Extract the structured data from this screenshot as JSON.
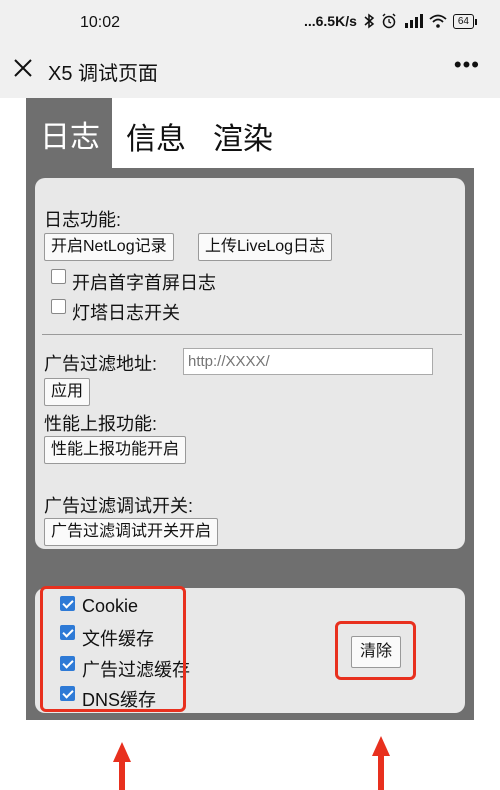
{
  "status_bar": {
    "time": "10:02",
    "net_speed": "...6.5K/s",
    "icons": [
      "bluetooth-icon",
      "alarm-icon",
      "signal-icon",
      "wifi-icon"
    ],
    "battery": "64"
  },
  "title_bar": {
    "title": "X5 调试页面",
    "more": "•••"
  },
  "tabs": [
    {
      "label": "日志",
      "active": true
    },
    {
      "label": "信息",
      "active": false
    },
    {
      "label": "渲染",
      "active": false
    }
  ],
  "log_section": {
    "label": "日志功能:",
    "buttons": [
      "开启NetLog记录",
      "上传LiveLog日志"
    ],
    "checkboxes": [
      {
        "label": "开启首字首屏日志",
        "checked": false
      },
      {
        "label": "灯塔日志开关",
        "checked": false
      }
    ]
  },
  "ad_filter": {
    "label": "广告过滤地址:",
    "placeholder": "http://XXXX/",
    "apply_button": "应用"
  },
  "perf": {
    "label": "性能上报功能:",
    "button": "性能上报功能开启"
  },
  "ad_debug": {
    "label": "广告过滤调试开关:",
    "button": "广告过滤调试开关开启"
  },
  "cache": {
    "checkboxes": [
      {
        "label": "Cookie",
        "checked": true
      },
      {
        "label": "文件缓存",
        "checked": true
      },
      {
        "label": "广告过滤缓存",
        "checked": true
      },
      {
        "label": "DNS缓存",
        "checked": true
      }
    ],
    "clear_button": "清除"
  },
  "colors": {
    "accent_red": "#e8301e",
    "panel_gray": "#6f6f6f",
    "card_gray": "#e8e8e8",
    "checkbox_blue": "#2e7ad6"
  }
}
